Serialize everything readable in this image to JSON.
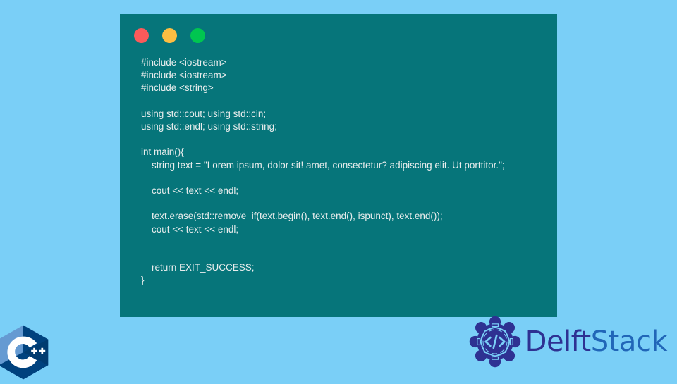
{
  "theme": {
    "page_background": "#7ACFF7",
    "code_panel_background": "#06757A",
    "code_text_color": "#E9EDED",
    "dot_red": "#FB5A5A",
    "dot_yellow": "#FDBE42",
    "dot_green": "#00C650",
    "cpp_light_blue": "#659AD2",
    "cpp_mid_blue": "#004482",
    "cpp_dark_blue": "#00599C",
    "delft_navy": "#2E3192",
    "stack_blue": "#2166B8"
  },
  "code_window": {
    "controls": [
      {
        "name": "close-dot",
        "color": "#FB5A5A"
      },
      {
        "name": "minimize-dot",
        "color": "#FDBE42"
      },
      {
        "name": "maximize-dot",
        "color": "#00C650"
      }
    ],
    "language": "C++",
    "lines": [
      "#include <iostream>",
      "#include <iostream>",
      "#include <string>",
      "",
      "using std::cout; using std::cin;",
      "using std::endl; using std::string;",
      "",
      "int main(){",
      "    string text = \"Lorem ipsum, dolor sit! amet, consectetur? adipiscing elit. Ut porttitor.\";",
      "",
      "    cout << text << endl;",
      "",
      "    text.erase(std::remove_if(text.begin(), text.end(), ispunct), text.end());",
      "    cout << text << endl;",
      "",
      "",
      "    return EXIT_SUCCESS;",
      "}"
    ]
  },
  "branding": {
    "cpp_logo": {
      "letter": "C",
      "plus_marks": "++",
      "alt": "C++ logo"
    },
    "delftstack": {
      "emblem_symbol": "</>",
      "word_first": "Delft",
      "word_second": "Stack"
    }
  }
}
